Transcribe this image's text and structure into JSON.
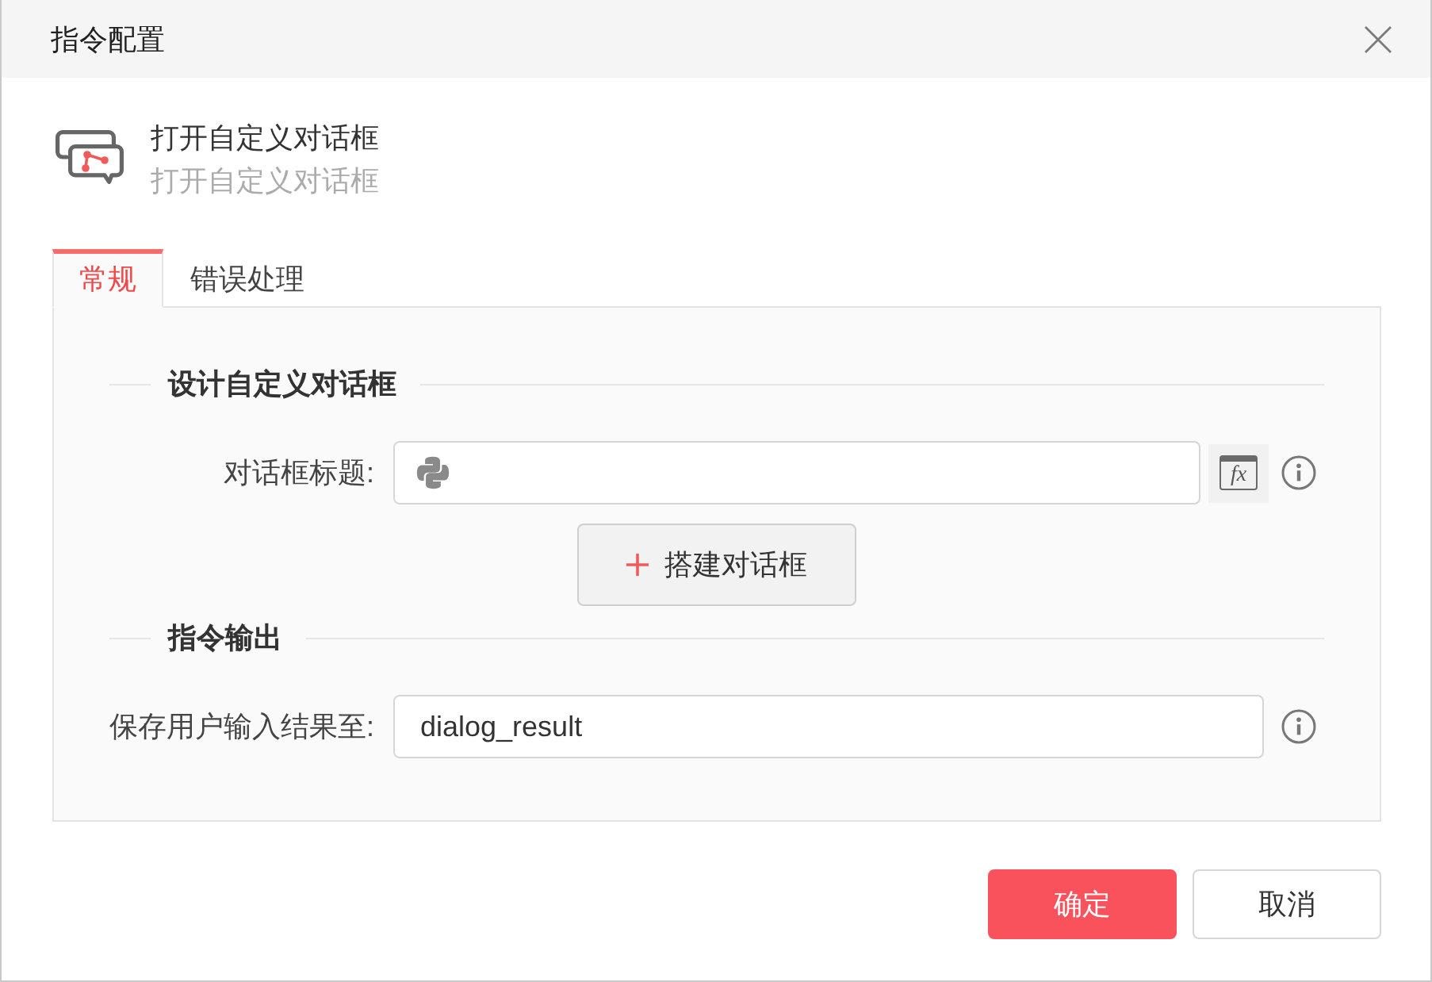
{
  "window": {
    "title": "指令配置"
  },
  "command": {
    "title": "打开自定义对话框",
    "subtitle": "打开自定义对话框"
  },
  "tabs": [
    {
      "label": "常规",
      "selected": true
    },
    {
      "label": "错误处理",
      "selected": false
    }
  ],
  "sections": [
    {
      "title": "设计自定义对话框",
      "rows": [
        {
          "kind": "code_field",
          "label": "对话框标题:",
          "formula_button": "fx",
          "help": true
        },
        {
          "kind": "button",
          "label": "搭建对话框"
        }
      ]
    },
    {
      "title": "指令输出",
      "rows": [
        {
          "kind": "text_field",
          "label": "保存用户输入结果至:",
          "value": "dialog_result",
          "help": true
        }
      ]
    }
  ],
  "buttons": [
    {
      "label": "确定",
      "kind": "primary"
    },
    {
      "label": "取消",
      "kind": "default"
    }
  ]
}
